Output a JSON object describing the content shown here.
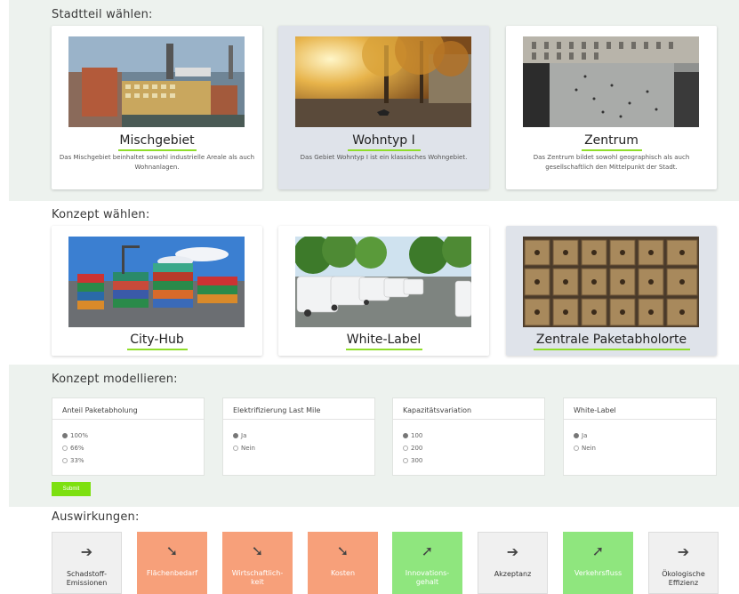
{
  "stadtteil": {
    "title": "Stadtteil wählen:",
    "items": [
      {
        "name": "Mischgebiet",
        "desc": "Das Mischgebiet beinhaltet sowohl industrielle Areale als auch Wohnanlagen.",
        "selected": false
      },
      {
        "name": "Wohntyp I",
        "desc": "Das Gebiet Wohntyp I ist ein klassisches Wohngebiet.",
        "selected": true
      },
      {
        "name": "Zentrum",
        "desc": "Das Zentrum bildet sowohl geographisch als auch gesellschaftlich den Mittelpunkt der Stadt.",
        "selected": false
      }
    ]
  },
  "konzept": {
    "title": "Konzept wählen:",
    "items": [
      {
        "name": "City-Hub",
        "selected": false
      },
      {
        "name": "White-Label",
        "selected": false
      },
      {
        "name": "Zentrale Paketabholorte",
        "selected": true
      }
    ]
  },
  "modell": {
    "title": "Konzept modellieren:",
    "groups": [
      {
        "label": "Anteil Paketabholung",
        "options": [
          "100%",
          "66%",
          "33%"
        ],
        "selected": 0
      },
      {
        "label": "Elektrifizierung Last Mile",
        "options": [
          "Ja",
          "Nein"
        ],
        "selected": 0
      },
      {
        "label": "Kapazitätsvariation",
        "options": [
          "100",
          "200",
          "300"
        ],
        "selected": 0
      },
      {
        "label": "White-Label",
        "options": [
          "Ja",
          "Nein"
        ],
        "selected": 0
      }
    ],
    "submit_label": "Submit"
  },
  "auswirkungen": {
    "title": "Auswirkungen:",
    "tiles": [
      {
        "label": "Schadstoff-\nEmissionen",
        "arrow": "➔",
        "trend": "neutral",
        "icon": "arrow-right-icon"
      },
      {
        "label": "Flächenbedarf",
        "arrow": "➘",
        "trend": "down",
        "icon": "arrow-down-right-icon"
      },
      {
        "label": "Wirtschaftlich-\nkeit",
        "arrow": "➘",
        "trend": "down",
        "icon": "arrow-down-right-icon"
      },
      {
        "label": "Kosten",
        "arrow": "➘",
        "trend": "down",
        "icon": "arrow-down-right-icon"
      },
      {
        "label": "Innovations-\ngehalt",
        "arrow": "➚",
        "trend": "up",
        "icon": "arrow-up-right-icon"
      },
      {
        "label": "Akzeptanz",
        "arrow": "➔",
        "trend": "neutral",
        "icon": "arrow-right-icon"
      },
      {
        "label": "Verkehrsfluss",
        "arrow": "➚",
        "trend": "up",
        "icon": "arrow-up-right-icon"
      },
      {
        "label": "Ökologische\nEffizienz",
        "arrow": "➔",
        "trend": "neutral",
        "icon": "arrow-right-icon"
      }
    ]
  },
  "colors": {
    "accent": "#8fdd2a",
    "submit": "#7de010",
    "bad": "#f7a07a",
    "good": "#8fe67e",
    "neutral": "#f0f0f0",
    "selected_card": "#dfe3ea",
    "band": "#edf2ee"
  }
}
